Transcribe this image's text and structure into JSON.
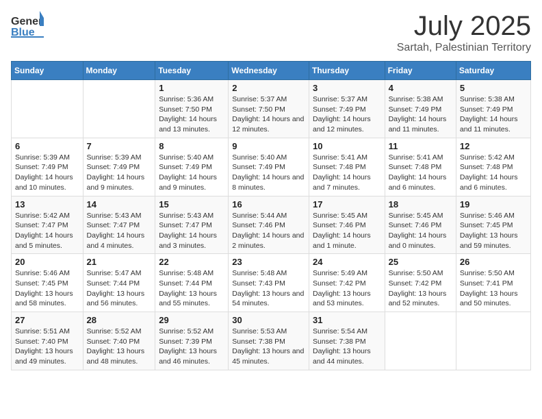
{
  "header": {
    "logo_general": "General",
    "logo_blue": "Blue",
    "month": "July 2025",
    "location": "Sartah, Palestinian Territory"
  },
  "days_of_week": [
    "Sunday",
    "Monday",
    "Tuesday",
    "Wednesday",
    "Thursday",
    "Friday",
    "Saturday"
  ],
  "weeks": [
    [
      {
        "day": "",
        "sunrise": "",
        "sunset": "",
        "daylight": ""
      },
      {
        "day": "",
        "sunrise": "",
        "sunset": "",
        "daylight": ""
      },
      {
        "day": "1",
        "sunrise": "Sunrise: 5:36 AM",
        "sunset": "Sunset: 7:50 PM",
        "daylight": "Daylight: 14 hours and 13 minutes."
      },
      {
        "day": "2",
        "sunrise": "Sunrise: 5:37 AM",
        "sunset": "Sunset: 7:50 PM",
        "daylight": "Daylight: 14 hours and 12 minutes."
      },
      {
        "day": "3",
        "sunrise": "Sunrise: 5:37 AM",
        "sunset": "Sunset: 7:49 PM",
        "daylight": "Daylight: 14 hours and 12 minutes."
      },
      {
        "day": "4",
        "sunrise": "Sunrise: 5:38 AM",
        "sunset": "Sunset: 7:49 PM",
        "daylight": "Daylight: 14 hours and 11 minutes."
      },
      {
        "day": "5",
        "sunrise": "Sunrise: 5:38 AM",
        "sunset": "Sunset: 7:49 PM",
        "daylight": "Daylight: 14 hours and 11 minutes."
      }
    ],
    [
      {
        "day": "6",
        "sunrise": "Sunrise: 5:39 AM",
        "sunset": "Sunset: 7:49 PM",
        "daylight": "Daylight: 14 hours and 10 minutes."
      },
      {
        "day": "7",
        "sunrise": "Sunrise: 5:39 AM",
        "sunset": "Sunset: 7:49 PM",
        "daylight": "Daylight: 14 hours and 9 minutes."
      },
      {
        "day": "8",
        "sunrise": "Sunrise: 5:40 AM",
        "sunset": "Sunset: 7:49 PM",
        "daylight": "Daylight: 14 hours and 9 minutes."
      },
      {
        "day": "9",
        "sunrise": "Sunrise: 5:40 AM",
        "sunset": "Sunset: 7:49 PM",
        "daylight": "Daylight: 14 hours and 8 minutes."
      },
      {
        "day": "10",
        "sunrise": "Sunrise: 5:41 AM",
        "sunset": "Sunset: 7:48 PM",
        "daylight": "Daylight: 14 hours and 7 minutes."
      },
      {
        "day": "11",
        "sunrise": "Sunrise: 5:41 AM",
        "sunset": "Sunset: 7:48 PM",
        "daylight": "Daylight: 14 hours and 6 minutes."
      },
      {
        "day": "12",
        "sunrise": "Sunrise: 5:42 AM",
        "sunset": "Sunset: 7:48 PM",
        "daylight": "Daylight: 14 hours and 6 minutes."
      }
    ],
    [
      {
        "day": "13",
        "sunrise": "Sunrise: 5:42 AM",
        "sunset": "Sunset: 7:47 PM",
        "daylight": "Daylight: 14 hours and 5 minutes."
      },
      {
        "day": "14",
        "sunrise": "Sunrise: 5:43 AM",
        "sunset": "Sunset: 7:47 PM",
        "daylight": "Daylight: 14 hours and 4 minutes."
      },
      {
        "day": "15",
        "sunrise": "Sunrise: 5:43 AM",
        "sunset": "Sunset: 7:47 PM",
        "daylight": "Daylight: 14 hours and 3 minutes."
      },
      {
        "day": "16",
        "sunrise": "Sunrise: 5:44 AM",
        "sunset": "Sunset: 7:46 PM",
        "daylight": "Daylight: 14 hours and 2 minutes."
      },
      {
        "day": "17",
        "sunrise": "Sunrise: 5:45 AM",
        "sunset": "Sunset: 7:46 PM",
        "daylight": "Daylight: 14 hours and 1 minute."
      },
      {
        "day": "18",
        "sunrise": "Sunrise: 5:45 AM",
        "sunset": "Sunset: 7:46 PM",
        "daylight": "Daylight: 14 hours and 0 minutes."
      },
      {
        "day": "19",
        "sunrise": "Sunrise: 5:46 AM",
        "sunset": "Sunset: 7:45 PM",
        "daylight": "Daylight: 13 hours and 59 minutes."
      }
    ],
    [
      {
        "day": "20",
        "sunrise": "Sunrise: 5:46 AM",
        "sunset": "Sunset: 7:45 PM",
        "daylight": "Daylight: 13 hours and 58 minutes."
      },
      {
        "day": "21",
        "sunrise": "Sunrise: 5:47 AM",
        "sunset": "Sunset: 7:44 PM",
        "daylight": "Daylight: 13 hours and 56 minutes."
      },
      {
        "day": "22",
        "sunrise": "Sunrise: 5:48 AM",
        "sunset": "Sunset: 7:44 PM",
        "daylight": "Daylight: 13 hours and 55 minutes."
      },
      {
        "day": "23",
        "sunrise": "Sunrise: 5:48 AM",
        "sunset": "Sunset: 7:43 PM",
        "daylight": "Daylight: 13 hours and 54 minutes."
      },
      {
        "day": "24",
        "sunrise": "Sunrise: 5:49 AM",
        "sunset": "Sunset: 7:42 PM",
        "daylight": "Daylight: 13 hours and 53 minutes."
      },
      {
        "day": "25",
        "sunrise": "Sunrise: 5:50 AM",
        "sunset": "Sunset: 7:42 PM",
        "daylight": "Daylight: 13 hours and 52 minutes."
      },
      {
        "day": "26",
        "sunrise": "Sunrise: 5:50 AM",
        "sunset": "Sunset: 7:41 PM",
        "daylight": "Daylight: 13 hours and 50 minutes."
      }
    ],
    [
      {
        "day": "27",
        "sunrise": "Sunrise: 5:51 AM",
        "sunset": "Sunset: 7:40 PM",
        "daylight": "Daylight: 13 hours and 49 minutes."
      },
      {
        "day": "28",
        "sunrise": "Sunrise: 5:52 AM",
        "sunset": "Sunset: 7:40 PM",
        "daylight": "Daylight: 13 hours and 48 minutes."
      },
      {
        "day": "29",
        "sunrise": "Sunrise: 5:52 AM",
        "sunset": "Sunset: 7:39 PM",
        "daylight": "Daylight: 13 hours and 46 minutes."
      },
      {
        "day": "30",
        "sunrise": "Sunrise: 5:53 AM",
        "sunset": "Sunset: 7:38 PM",
        "daylight": "Daylight: 13 hours and 45 minutes."
      },
      {
        "day": "31",
        "sunrise": "Sunrise: 5:54 AM",
        "sunset": "Sunset: 7:38 PM",
        "daylight": "Daylight: 13 hours and 44 minutes."
      },
      {
        "day": "",
        "sunrise": "",
        "sunset": "",
        "daylight": ""
      },
      {
        "day": "",
        "sunrise": "",
        "sunset": "",
        "daylight": ""
      }
    ]
  ]
}
